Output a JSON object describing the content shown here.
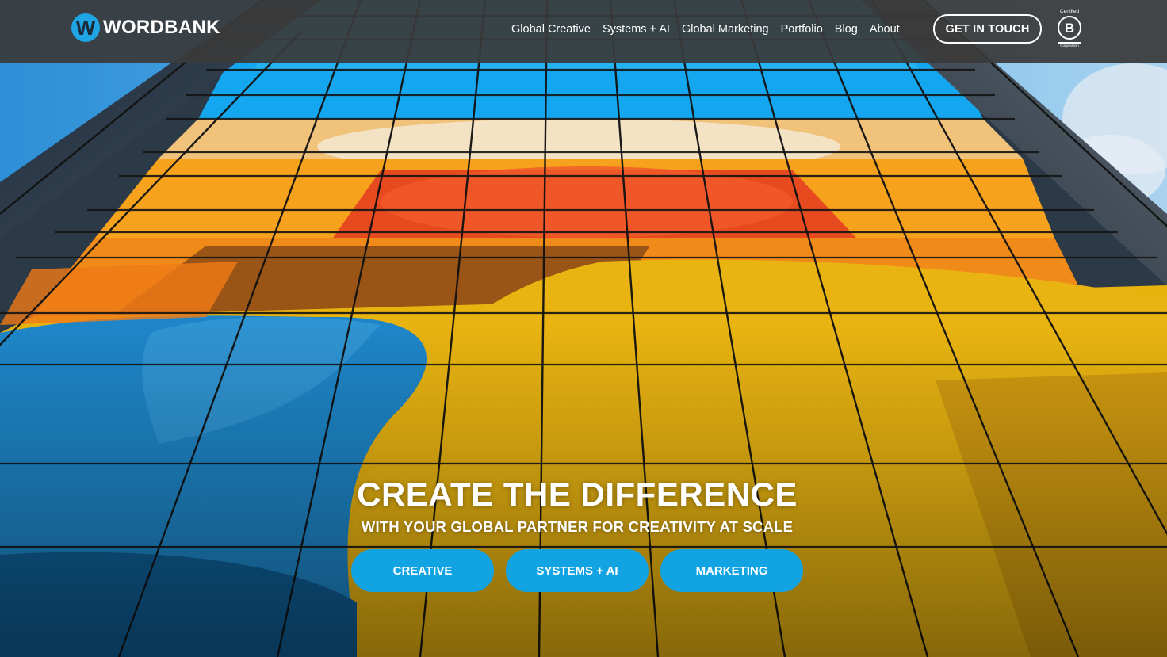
{
  "header": {
    "logo_letter": "W",
    "logo_text": "WORDBANK",
    "nav": [
      {
        "label": "Global Creative"
      },
      {
        "label": "Systems + AI"
      },
      {
        "label": "Global Marketing"
      },
      {
        "label": "Portfolio"
      },
      {
        "label": "Blog"
      },
      {
        "label": "About"
      }
    ],
    "cta_label": "GET IN TOUCH",
    "badge": {
      "top": "Certified",
      "letter": "B",
      "bottom": "Corporation"
    }
  },
  "hero": {
    "headline": "CREATE THE DIFFERENCE",
    "subheadline": "WITH YOUR GLOBAL PARTNER FOR CREATIVITY AT SCALE",
    "buttons": [
      {
        "label": "CREATIVE"
      },
      {
        "label": "SYSTEMS + AI"
      },
      {
        "label": "MARKETING"
      }
    ]
  },
  "colors": {
    "brand_blue": "#12a3e3",
    "header_bg": "#3a3a3a",
    "text": "#ffffff"
  }
}
